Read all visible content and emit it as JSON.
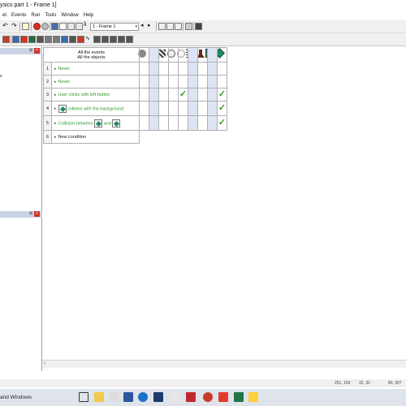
{
  "window": {
    "title": "ysics part 1 - Frame 1]"
  },
  "menu": {
    "items": [
      "et",
      "Events",
      "Run",
      "Tools",
      "Window",
      "Help"
    ]
  },
  "toolbar": {
    "frame_select": "1 - Frame 1"
  },
  "left_panel": {
    "partial_text": "e"
  },
  "events": {
    "header_line1": "All the events",
    "header_line2": "All the objects",
    "rows": [
      {
        "num": "1",
        "text": "Never",
        "checks": []
      },
      {
        "num": "2",
        "text": "Never",
        "checks": []
      },
      {
        "num": "3",
        "text": "User clicks with left button",
        "checks": [
          5,
          8
        ]
      },
      {
        "num": "4",
        "pre": "",
        "text": "collides with the background",
        "checks": [
          8
        ]
      },
      {
        "num": "5",
        "pre": "Collision between",
        "mid": "and",
        "checks": [
          8
        ]
      },
      {
        "num": "6",
        "text": "New condition",
        "checks": []
      }
    ],
    "check_symbol": "✓"
  },
  "status": {
    "coords": "251, 150",
    "size": "32, 32",
    "zoom": "80, 307"
  },
  "taskbar": {
    "label": "and Windows"
  },
  "colors": {
    "event_green": "#2e9a2e",
    "alt_column": "#dde4f3",
    "panel_head": "#c9d3e3"
  }
}
